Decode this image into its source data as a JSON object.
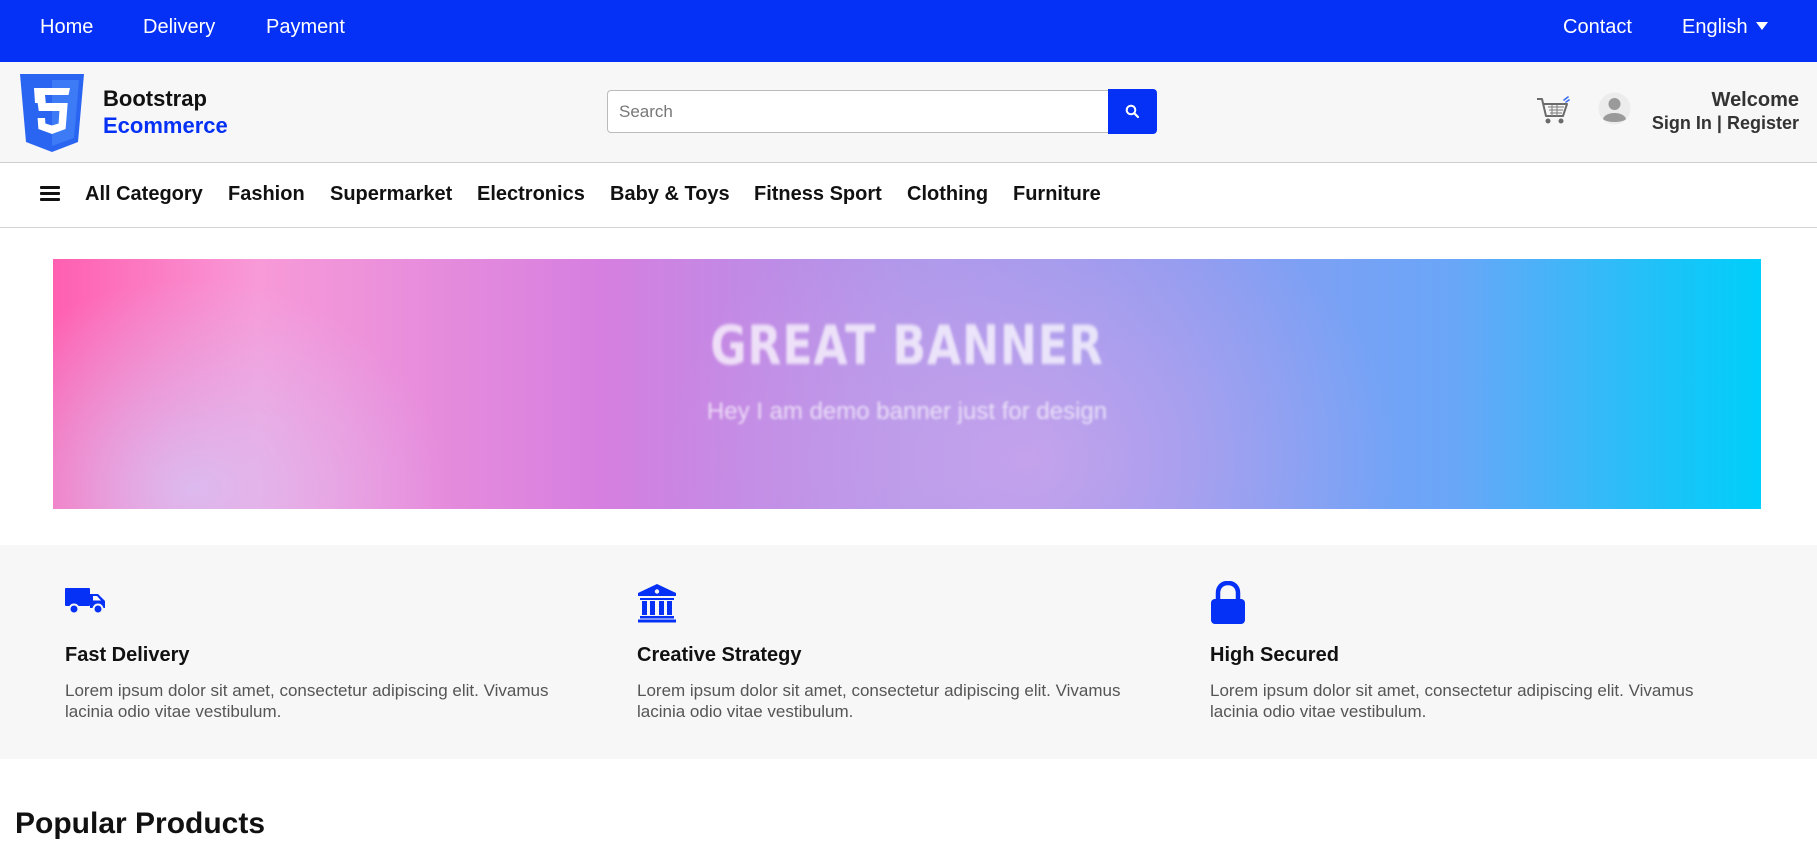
{
  "topbar": {
    "home": "Home",
    "delivery": "Delivery",
    "payment": "Payment",
    "contact": "Contact",
    "language": "English",
    "bg_color": "#0530f5"
  },
  "header": {
    "brand_line1": "Bootstrap",
    "brand_line2": "Ecommerce",
    "search_placeholder": "Search",
    "welcome": "Welcome",
    "sign_in": "Sign In",
    "separator": " | ",
    "register": "Register",
    "icons": [
      "css3-logo-icon",
      "search-icon",
      "cart-icon",
      "user-icon"
    ]
  },
  "categories": {
    "menu_icon": "hamburger-menu-icon",
    "items": [
      "All Category",
      "Fashion",
      "Supermarket",
      "Electronics",
      "Baby & Toys",
      "Fitness Sport",
      "Clothing",
      "Furniture"
    ]
  },
  "banner": {
    "title": "GREAT BANNER",
    "subtitle": "Hey I am demo banner just for design"
  },
  "features": [
    {
      "icon": "truck-icon",
      "title": "Fast Delivery",
      "text": "Lorem ipsum dolor sit amet, consectetur adipiscing elit. Vivamus lacinia odio vitae vestibulum."
    },
    {
      "icon": "bank-icon",
      "title": "Creative Strategy",
      "text": "Lorem ipsum dolor sit amet, consectetur adipiscing elit. Vivamus lacinia odio vitae vestibulum."
    },
    {
      "icon": "lock-icon",
      "title": "High Secured",
      "text": "Lorem ipsum dolor sit amet, consectetur adipiscing elit. Vivamus lacinia odio vitae vestibulum."
    }
  ],
  "popular": {
    "heading": "Popular Products"
  },
  "colors": {
    "accent": "#0530f5",
    "header_bg": "#f7f7f7",
    "feature_bg": "#f7f7f7"
  }
}
